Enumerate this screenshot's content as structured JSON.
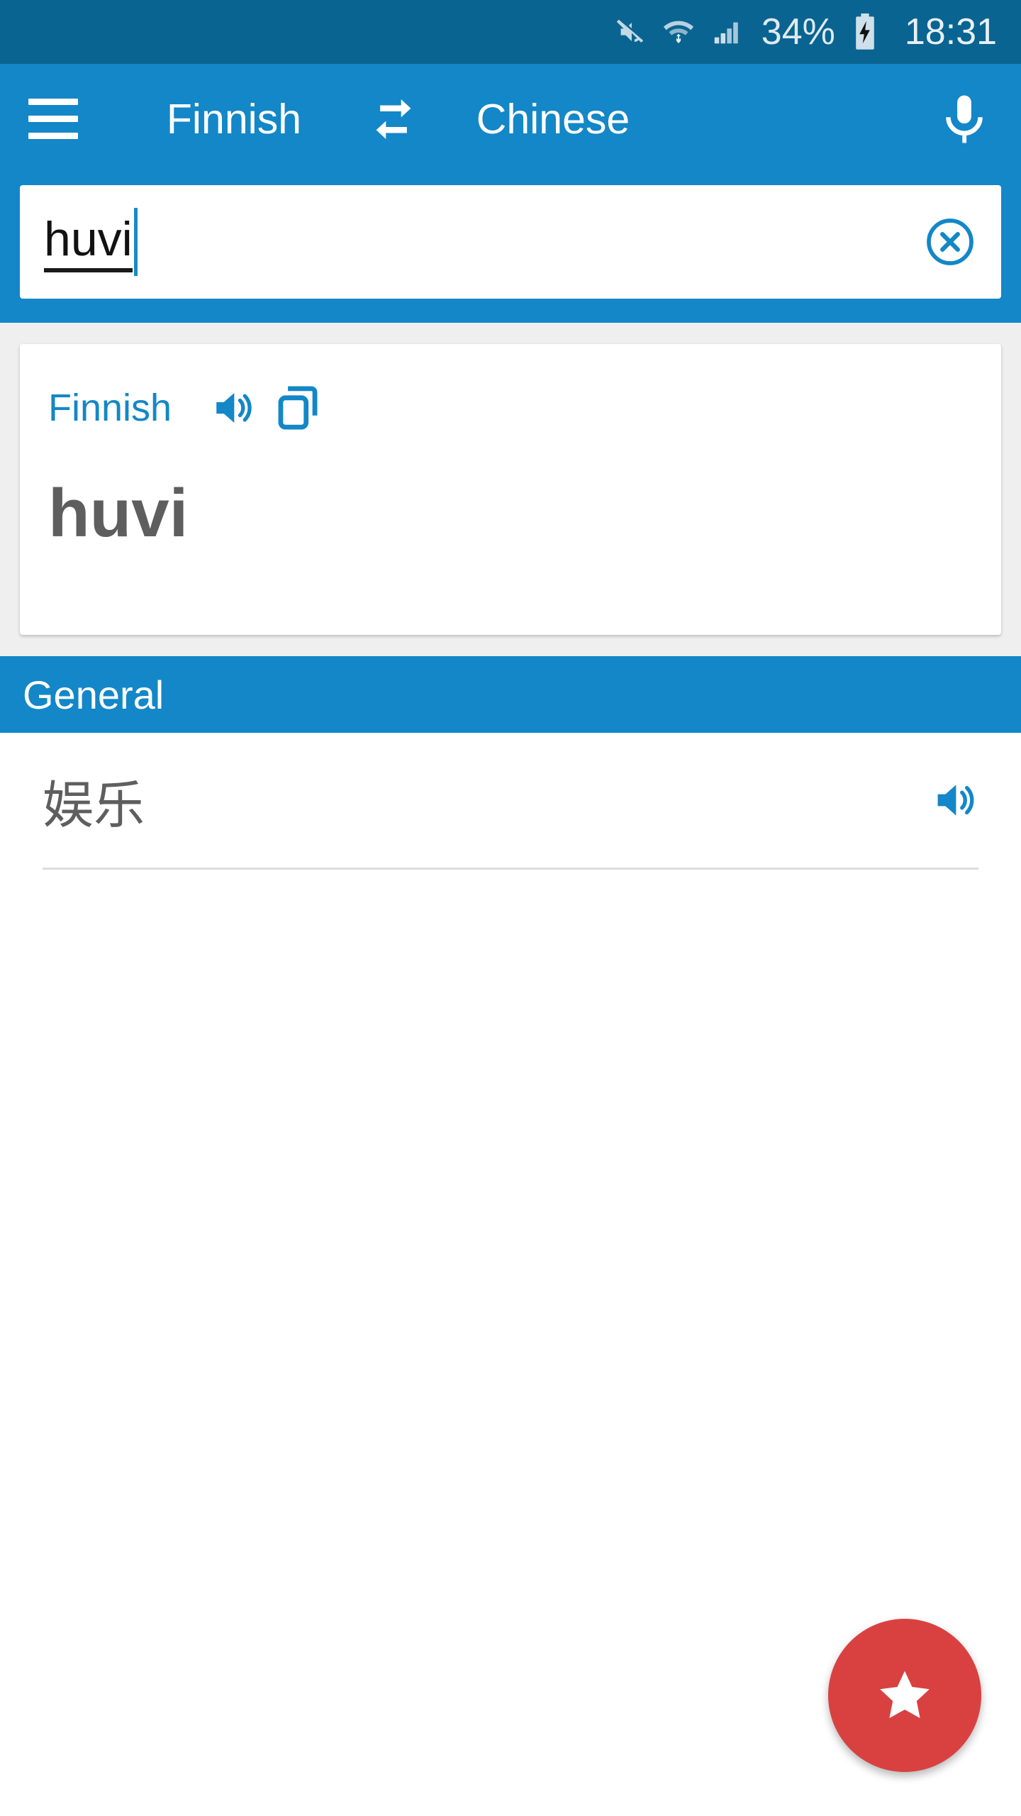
{
  "status_bar": {
    "battery_percent": "34%",
    "clock": "18:31",
    "icons": [
      "mute-icon",
      "wifi-icon",
      "cellular-signal-icon",
      "battery-charging-icon"
    ],
    "background_color": "#0a6491",
    "text_color": "#dfeaf1"
  },
  "app_bar": {
    "menu_icon": "hamburger-menu-icon",
    "source_language": "Finnish",
    "swap_icon": "swap-horizontal-icon",
    "target_language": "Chinese",
    "mic_icon": "microphone-icon",
    "background_color": "#1387c7"
  },
  "search": {
    "value": "huvi",
    "placeholder": "",
    "clear_icon": "clear-circle-icon"
  },
  "card": {
    "language_label": "Finnish",
    "speak_icon": "speaker-icon",
    "copy_icon": "copy-icon",
    "term": "huvi",
    "term_color": "#5e5e5e",
    "accent_color": "#1387c7"
  },
  "section": {
    "title": "General"
  },
  "results": [
    {
      "text": "娱乐",
      "speak_icon": "speaker-icon"
    }
  ],
  "fab": {
    "icon": "star-icon",
    "color": "#d94141"
  }
}
